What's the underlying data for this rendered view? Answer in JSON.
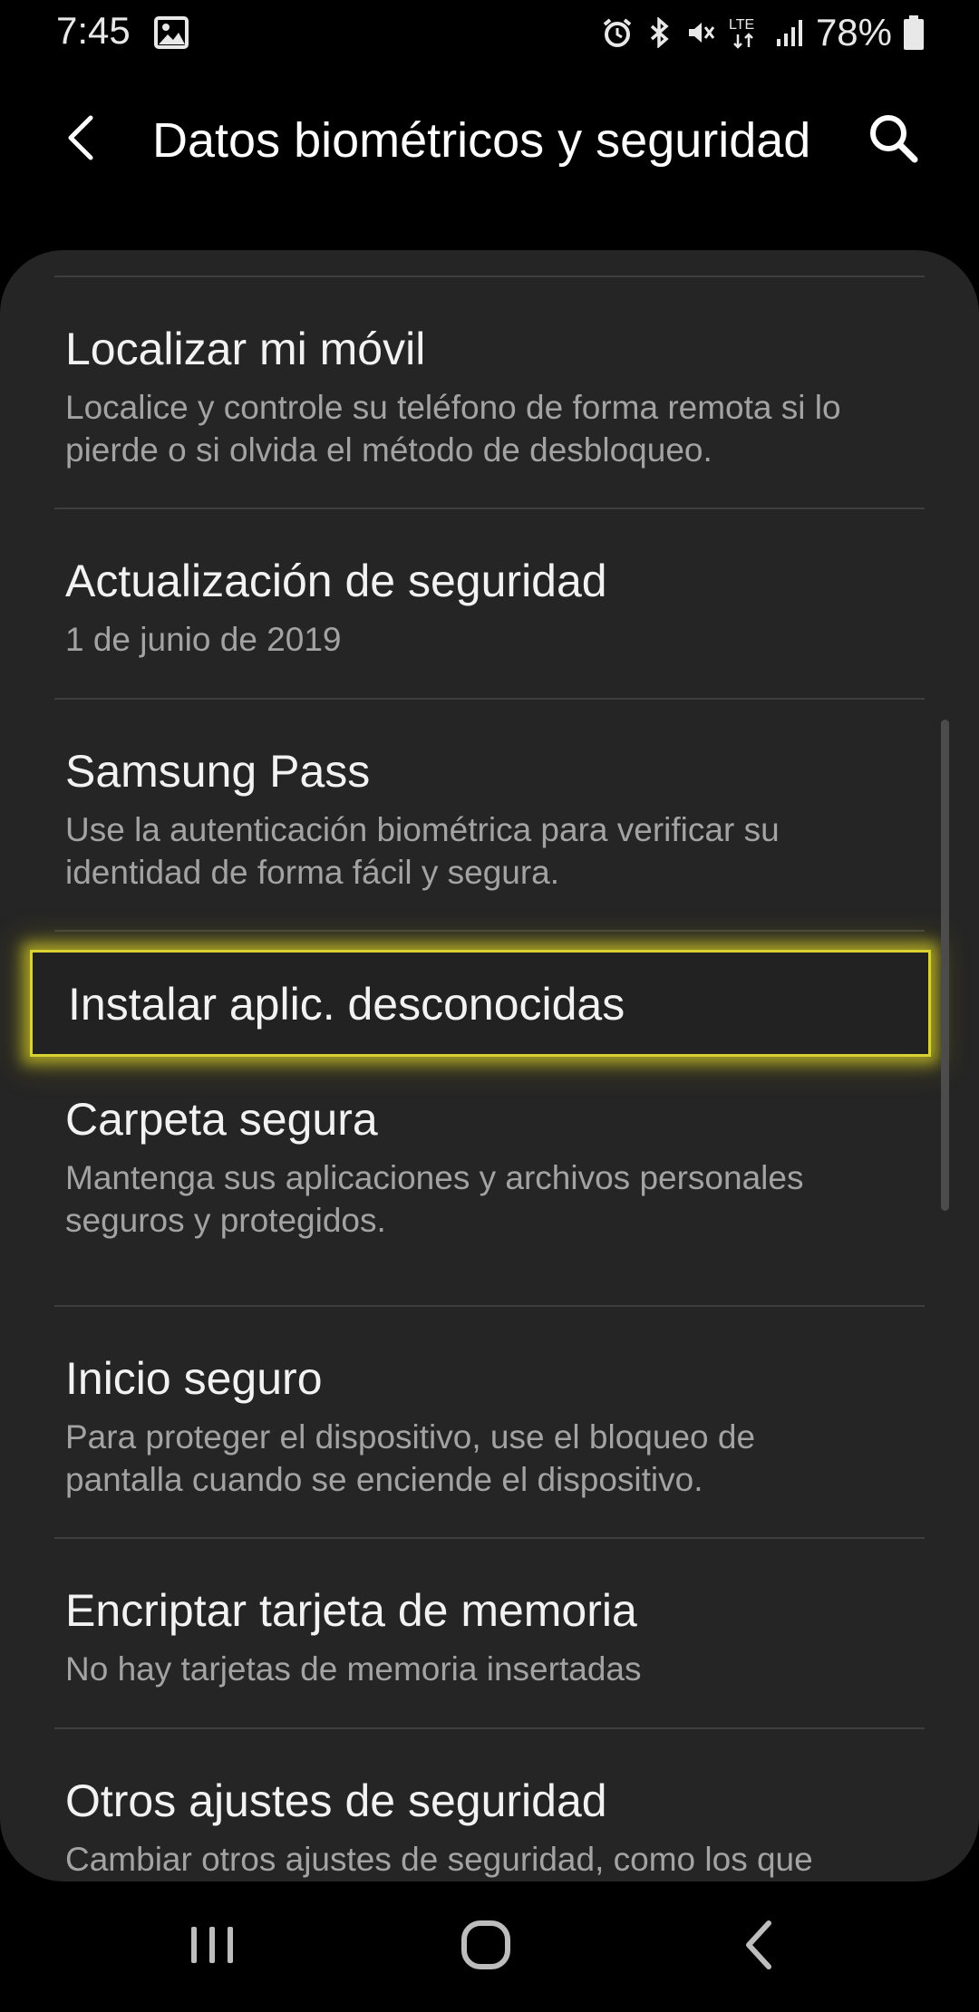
{
  "status_bar": {
    "time": "7:45",
    "battery": "78%",
    "network": "LTE"
  },
  "header": {
    "title": "Datos biométricos y seguridad"
  },
  "settings": [
    {
      "title": "Localizar mi móvil",
      "subtitle": "Localice y controle su teléfono de forma remota si lo pierde o si olvida el método de desbloqueo."
    },
    {
      "title": "Actualización de seguridad",
      "subtitle": "1 de junio de 2019"
    },
    {
      "title": "Samsung Pass",
      "subtitle": "Use la autenticación biométrica para verificar su identidad de forma fácil y segura."
    },
    {
      "title": "Instalar aplic. desconocidas",
      "subtitle": ""
    },
    {
      "title": "Carpeta segura",
      "subtitle": "Mantenga sus aplicaciones y archivos personales seguros y protegidos."
    },
    {
      "title": "Inicio seguro",
      "subtitle": "Para proteger el dispositivo, use el bloqueo de pantalla cuando se enciende el dispositivo."
    },
    {
      "title": "Encriptar tarjeta de memoria",
      "subtitle": "No hay tarjetas de memoria insertadas"
    },
    {
      "title": "Otros ajustes de seguridad",
      "subtitle": "Cambiar otros ajustes de seguridad, como los que"
    }
  ],
  "highlighted_item": "Instalar aplic. desconocidas",
  "icons": {
    "status": [
      "image-icon",
      "alarm-icon",
      "bluetooth-icon",
      "mute-icon",
      "lte-icon",
      "signal-icon",
      "battery-icon"
    ],
    "header": [
      "back-arrow-icon",
      "search-icon"
    ],
    "nav": [
      "recent-apps-icon",
      "home-icon",
      "back-icon"
    ]
  },
  "colors": {
    "background": "#000000",
    "card": "#252525",
    "title_text": "#f2f2f2",
    "subtitle_text": "#a3a3a3",
    "divider": "#3e3e3e",
    "highlight": "#d9d233"
  }
}
